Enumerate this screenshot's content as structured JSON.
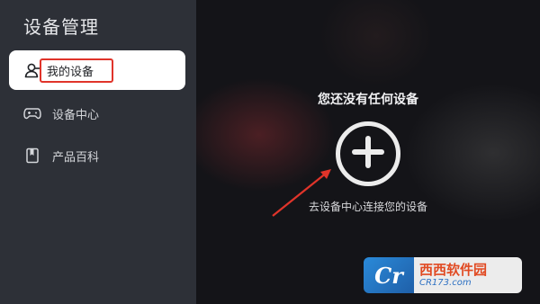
{
  "sidebar": {
    "title": "设备管理",
    "items": [
      {
        "label": "我的设备",
        "icon": "user-icon",
        "active": true
      },
      {
        "label": "设备中心",
        "icon": "gamepad-icon",
        "active": false
      },
      {
        "label": "产品百科",
        "icon": "book-icon",
        "active": false
      }
    ]
  },
  "main": {
    "empty_title": "您还没有任何设备",
    "add_icon": "plus-circle-icon",
    "hint": "去设备中心连接您的设备"
  },
  "annotation": {
    "highlight_color": "#e0342a",
    "arrow_color": "#e0342a"
  },
  "watermark": {
    "logo_text": "Cr",
    "name": "西西软件园",
    "site": "CR173.com"
  }
}
